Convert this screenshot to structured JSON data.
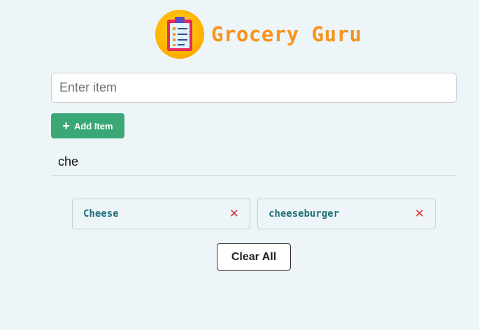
{
  "header": {
    "title": "Grocery Guru",
    "logo_icon": "clipboard-list-icon"
  },
  "item_input": {
    "placeholder": "Enter item",
    "value": ""
  },
  "add_button": {
    "label": "Add Item",
    "icon": "plus-icon"
  },
  "search_input": {
    "value": "che"
  },
  "items": [
    {
      "label": "Cheese",
      "remove_icon": "close-icon"
    },
    {
      "label": "cheeseburger",
      "remove_icon": "close-icon"
    }
  ],
  "clear_button": {
    "label": "Clear All"
  },
  "colors": {
    "background": "#edf5f8",
    "title": "#f7941d",
    "add_button": "#3aa876",
    "chip_text": "#1f6f7a",
    "remove": "#d9383b"
  }
}
